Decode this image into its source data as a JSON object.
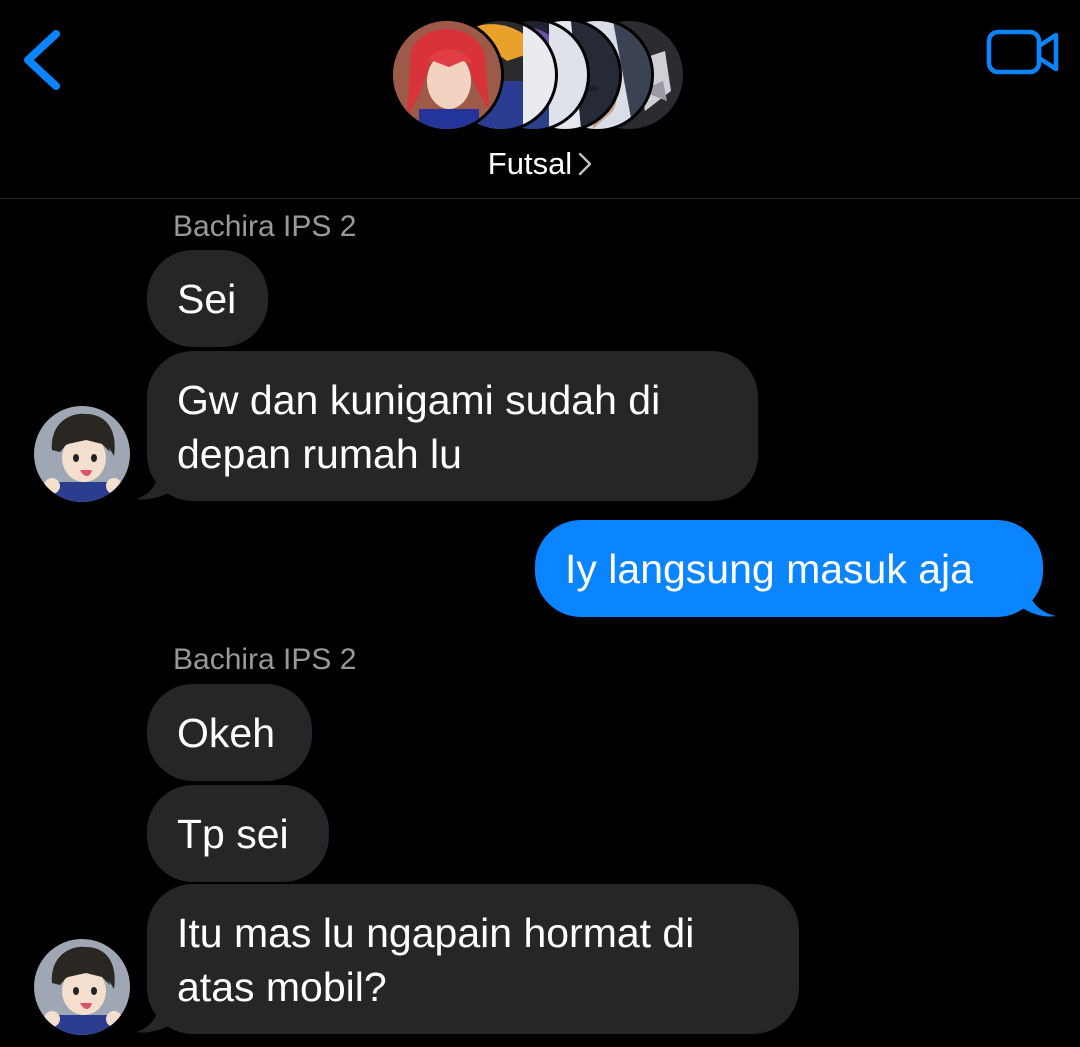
{
  "header": {
    "back_icon": "chevron-left-icon",
    "video_icon": "video-camera-icon",
    "group_name": "Futsal",
    "title_chevron": ">",
    "accent_color": "#0a84ff",
    "member_avatars": [
      "red-haired-player",
      "yellow-haired-player",
      "purple-haired-player",
      "player-4",
      "player-5",
      "player-6"
    ]
  },
  "messages": [
    {
      "type": "sender",
      "text": "Bachira IPS 2"
    },
    {
      "type": "incoming",
      "text": "Sei"
    },
    {
      "type": "incoming",
      "lines": [
        "Gw dan kunigami sudah di",
        "depan rumah lu"
      ],
      "avatar": "bachira-avatar"
    },
    {
      "type": "outgoing",
      "text": "Iy langsung masuk aja"
    },
    {
      "type": "sender",
      "text": "Bachira IPS 2"
    },
    {
      "type": "incoming",
      "text": "Okeh"
    },
    {
      "type": "incoming",
      "text": "Tp sei"
    },
    {
      "type": "incoming",
      "lines": [
        "Itu mas lu ngapain hormat di",
        "atas mobil?"
      ],
      "avatar": "bachira-avatar"
    }
  ],
  "colors": {
    "incoming_bubble": "#262628",
    "outgoing_bubble": "#0a84ff",
    "sender_name": "#98989d",
    "background": "#000000"
  }
}
